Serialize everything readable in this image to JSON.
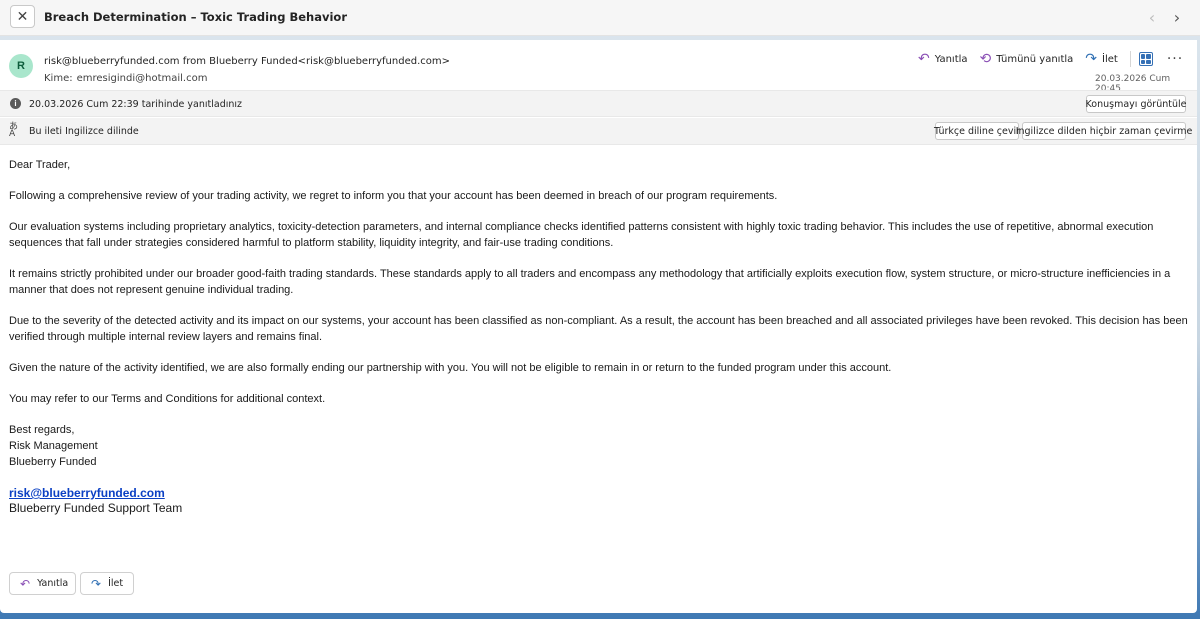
{
  "window": {
    "subject": "Breach Determination – Toxic Trading Behavior",
    "close_glyph": "✕",
    "prev_glyph": "‹",
    "next_glyph": "›"
  },
  "message": {
    "avatar_initial": "R",
    "from": "risk@blueberryfunded.com from Blueberry Funded<risk@blueberryfunded.com>",
    "to_label": "Kime:",
    "to_value": "emresigindi@hotmail.com",
    "date": "20.03.2026 Cum 20:45"
  },
  "actions": {
    "reply": "Yanıtla",
    "reply_all": "Tümünü yanıtla",
    "forward": "İlet",
    "more": "···"
  },
  "info_bar": {
    "text": "20.03.2026 Cum 22:39 tarihinde yanıtladınız",
    "button": "Konuşmayı görüntüle"
  },
  "translate_bar": {
    "text": "Bu ileti Ingilizce dilinde",
    "translate_button": "Türkçe diline çevir",
    "never_button": "Ingilizce dilden hiçbir zaman çevirme"
  },
  "body": {
    "greeting": "Dear Trader,",
    "p1": "Following a comprehensive review of your trading activity, we regret to inform you that your account has been deemed in breach of our program requirements.",
    "p2": "Our evaluation systems including proprietary analytics, toxicity-detection parameters, and internal compliance checks identified patterns consistent with highly toxic trading behavior. This includes the use of repetitive, abnormal execution sequences that fall under strategies considered harmful to platform stability, liquidity integrity, and fair-use trading conditions.",
    "p3": "It remains strictly prohibited under our broader good-faith trading standards. These standards apply to all traders and encompass any methodology that artificially exploits execution flow, system structure, or micro-structure inefficiencies in a manner that does not represent genuine individual trading.",
    "p4": "Due to the severity of the detected activity and its impact on our systems, your account has been classified as non-compliant. As a result, the account has been breached and all associated privileges have been revoked. This decision has been verified through multiple internal review layers and remains final.",
    "p5": "Given the nature of the activity identified, we are also formally ending our partnership with you. You will not be eligible to remain in or return to the funded program under this account.",
    "p6": "You may refer to our Terms and Conditions for additional context.",
    "closing_1": "Best regards,",
    "closing_2": "Risk Management",
    "closing_3": "Blueberry Funded",
    "sig_email": "risk@blueberryfunded.com",
    "sig_team": "Blueberry Funded Support Team"
  },
  "bottom": {
    "reply": "Yanıtla",
    "forward": "İlet"
  },
  "colors": {
    "reply_icon": "#8a4fb5",
    "forward_icon": "#2f6fb3",
    "link": "#0b40c4",
    "avatar_bg": "#a9e6cc"
  },
  "icons": {
    "reply": "reply-icon",
    "reply_all": "reply-all-icon",
    "forward": "forward-icon",
    "view": "grid-view-icon",
    "info": "info-icon",
    "translate": "translate-icon"
  }
}
